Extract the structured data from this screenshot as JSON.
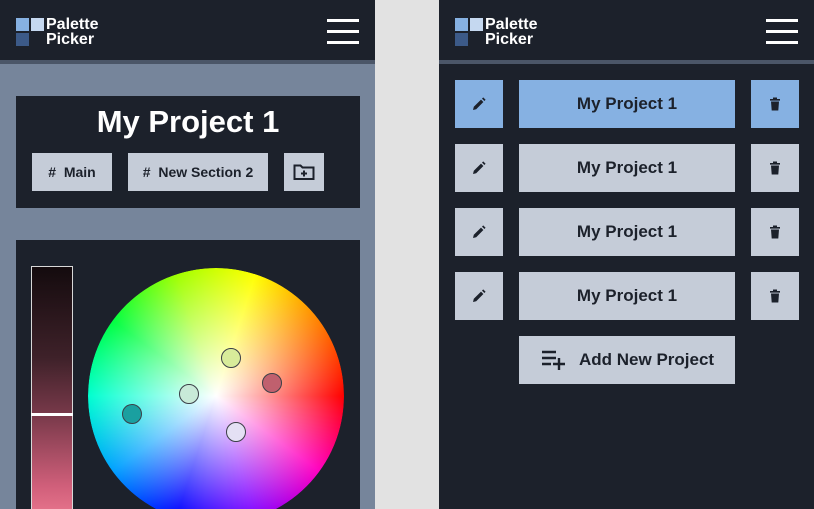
{
  "app": {
    "logo_line1": "Palette",
    "logo_line2": "Picker",
    "logo_colors": [
      "#86b1e2",
      "#c5d8f0",
      "#3c5a88"
    ]
  },
  "editor": {
    "project_title": "My Project 1",
    "sections": [
      {
        "hash": "#",
        "label": "Main"
      },
      {
        "hash": "#",
        "label": "New Section 2"
      }
    ],
    "add_section_icon": "folder-plus-icon",
    "selected_colors": [
      "#1aa0a0",
      "#d8ec9a",
      "#c8ead8",
      "#c0606e",
      "#e4e0f4"
    ],
    "lightness_gradient": [
      "#140b0e",
      "#7a3a4b",
      "#f07c93"
    ]
  },
  "project_list": {
    "projects": [
      {
        "name": "My Project 1",
        "active": true
      },
      {
        "name": "My Project 1",
        "active": false
      },
      {
        "name": "My Project 1",
        "active": false
      },
      {
        "name": "My Project 1",
        "active": false
      }
    ],
    "add_label": "Add New Project",
    "edit_icon": "pencil-icon",
    "delete_icon": "trash-icon"
  },
  "colors": {
    "dark": "#1c212b",
    "chip": "#c5ccd8",
    "accent": "#86b1e2",
    "left_bg": "#76859b"
  }
}
